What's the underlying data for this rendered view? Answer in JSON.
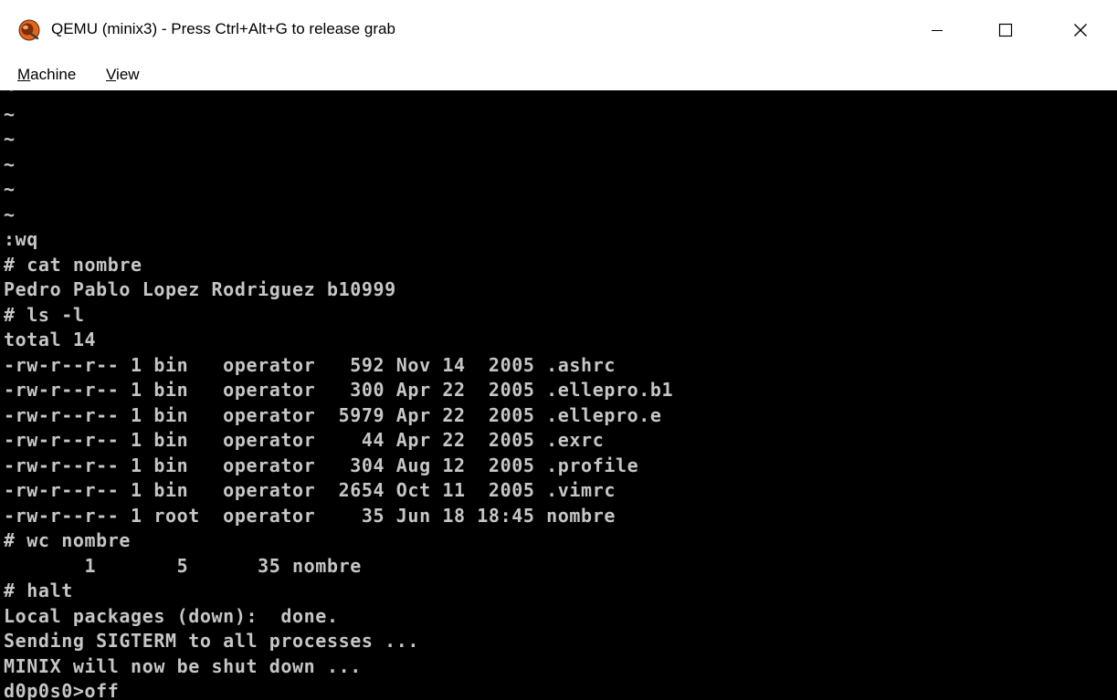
{
  "window": {
    "title": "QEMU (minix3) - Press Ctrl+Alt+G to release grab",
    "app_icon": "qemu-icon",
    "minimize_label": "—",
    "maximize_label": "□",
    "close_label": "✕"
  },
  "menu": {
    "machine_first": "M",
    "machine_rest": "achine",
    "view_first": "V",
    "view_rest": "iew"
  },
  "colors": {
    "terminal_bg": "#000000",
    "terminal_fg": "#c6c6c6",
    "chrome_bg": "#ffffff"
  },
  "terminal": {
    "lines": [
      "~",
      "~",
      "~",
      "~",
      "~",
      "~",
      ":wq",
      "# cat nombre",
      "Pedro Pablo Lopez Rodriguez b10999",
      "# ls -l",
      "total 14",
      "-rw-r--r-- 1 bin   operator   592 Nov 14  2005 .ashrc",
      "-rw-r--r-- 1 bin   operator   300 Apr 22  2005 .ellepro.b1",
      "-rw-r--r-- 1 bin   operator  5979 Apr 22  2005 .ellepro.e",
      "-rw-r--r-- 1 bin   operator    44 Apr 22  2005 .exrc",
      "-rw-r--r-- 1 bin   operator   304 Aug 12  2005 .profile",
      "-rw-r--r-- 1 bin   operator  2654 Oct 11  2005 .vimrc",
      "-rw-r--r-- 1 root  operator    35 Jun 18 18:45 nombre",
      "# wc nombre",
      "       1       5      35 nombre",
      "# halt",
      "Local packages (down):  done.",
      "Sending SIGTERM to all processes ...",
      "MINIX will now be shut down ...",
      "d0p0s0>off"
    ]
  }
}
